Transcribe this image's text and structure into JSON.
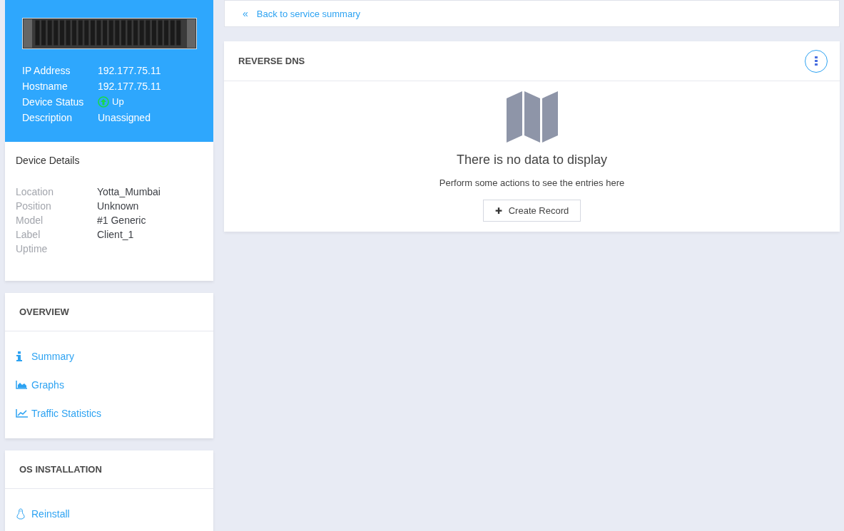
{
  "device": {
    "fields": [
      {
        "label": "IP Address",
        "value": "192.177.75.11",
        "kind": "text"
      },
      {
        "label": "Hostname",
        "value": "192.177.75.11",
        "kind": "text"
      },
      {
        "label": "Device Status",
        "value": "Up",
        "kind": "status"
      },
      {
        "label": "Description",
        "value": "Unassigned",
        "kind": "text"
      }
    ]
  },
  "details": {
    "title": "Device Details",
    "rows": [
      {
        "label": "Location",
        "value": "Yotta_Mumbai"
      },
      {
        "label": "Position",
        "value": "Unknown"
      },
      {
        "label": "Model",
        "value": "#1 Generic"
      },
      {
        "label": "Label",
        "value": "Client_1"
      },
      {
        "label": "Uptime"
      }
    ]
  },
  "menus": [
    {
      "title": "OVERVIEW",
      "items": [
        {
          "label": "Summary",
          "kind": "info"
        },
        {
          "label": "Graphs",
          "kind": "area"
        },
        {
          "label": "Traffic Statistics",
          "kind": "line"
        }
      ]
    },
    {
      "title": "OS INSTALLATION",
      "items": [
        {
          "label": "Reinstall",
          "kind": "linux"
        }
      ]
    }
  ],
  "back_link": {
    "icon": "«",
    "label": "Back to service summary"
  },
  "panel": {
    "title": "REVERSE DNS",
    "empty_title": "There is no data to display",
    "empty_text": "Perform some actions to see the entries here",
    "button": {
      "icon": "✚",
      "label": "Create Record"
    }
  }
}
